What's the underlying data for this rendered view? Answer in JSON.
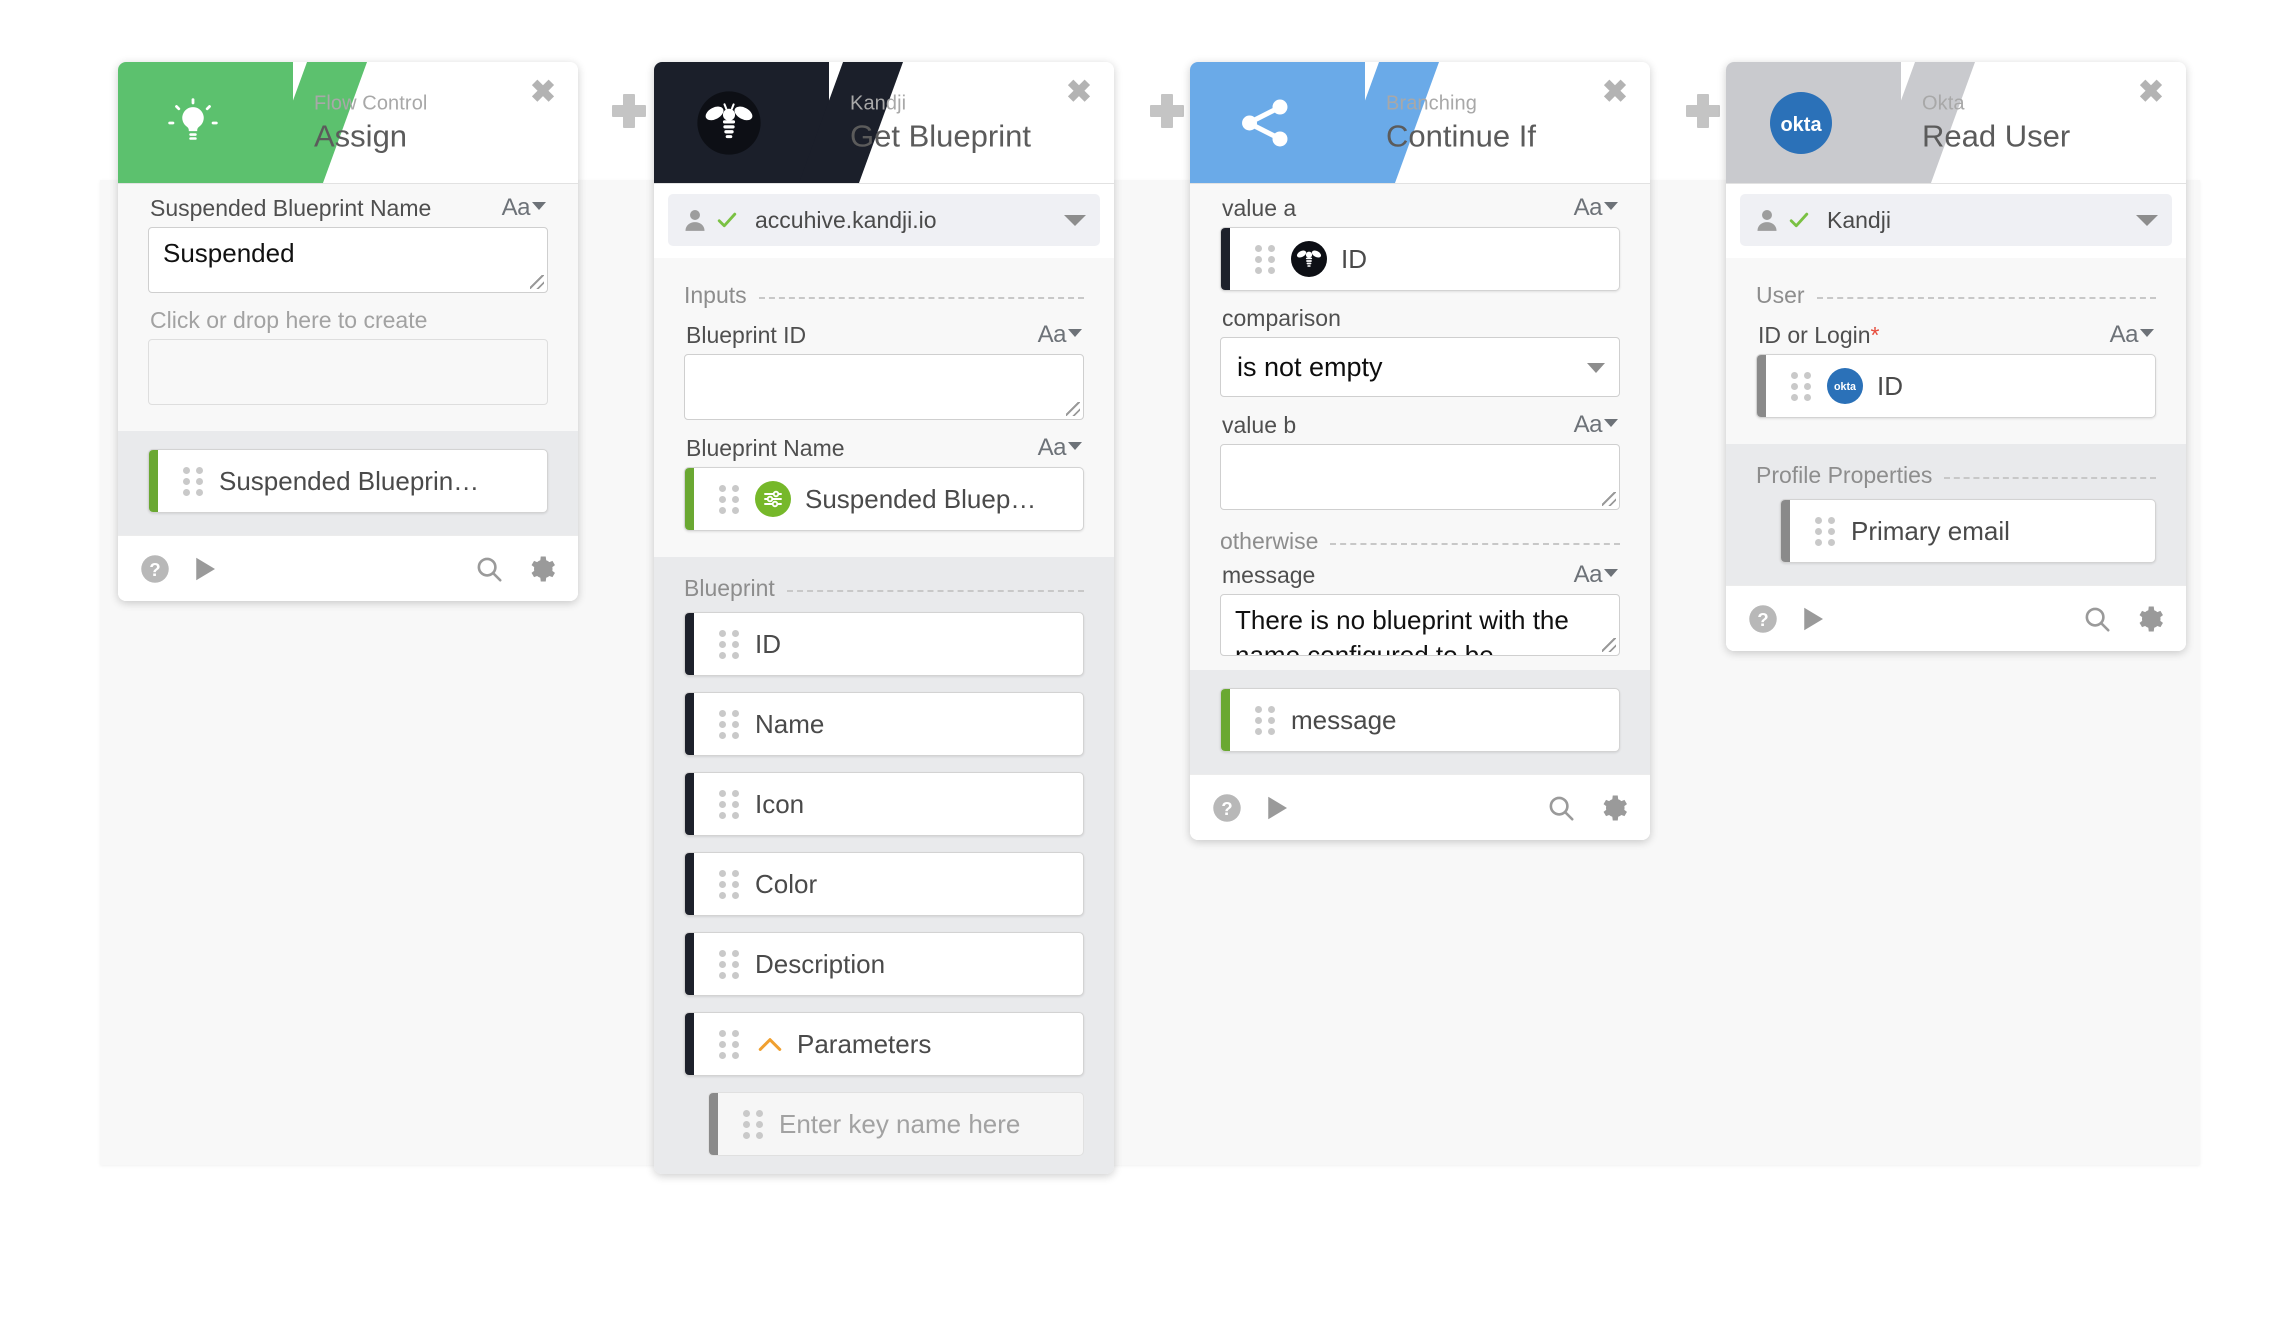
{
  "cards": [
    {
      "kicker": "Flow Control",
      "title": "Assign",
      "accent": "#5cc16e",
      "icon": "lightbulb-icon",
      "close_label": "✖",
      "fields": {
        "name_label": "Suspended Blueprint Name",
        "name_value": "Suspended",
        "aa_label": "Aa",
        "drop_label": "Click or drop here to create"
      },
      "outputs": [
        {
          "label": "Suspended Blueprin…",
          "accent": "green"
        }
      ]
    },
    {
      "kicker": "Kandji",
      "title": "Get Blueprint",
      "accent": "#1b1f2a",
      "icon": "bee-icon",
      "close_label": "✖",
      "account": {
        "name": "accuhive.kandji.io",
        "person_icon": "person-icon",
        "check_icon": "check-icon",
        "caret_icon": "chevron-down-icon"
      },
      "inputs_section": "Inputs",
      "fields": {
        "blueprint_id_label": "Blueprint ID",
        "blueprint_id_value": "",
        "blueprint_name_label": "Blueprint Name",
        "blueprint_name_token": "Suspended Bluep…",
        "aa_label": "Aa"
      },
      "outputs_section": "Blueprint",
      "outputs": [
        {
          "label": "ID",
          "accent": "dark"
        },
        {
          "label": "Name",
          "accent": "dark"
        },
        {
          "label": "Icon",
          "accent": "dark"
        },
        {
          "label": "Color",
          "accent": "dark"
        },
        {
          "label": "Description",
          "accent": "dark"
        },
        {
          "label": "Parameters",
          "accent": "dark",
          "chevron": "chevron-up-icon"
        }
      ],
      "parameters_placeholder": "Enter key name here"
    },
    {
      "kicker": "Branching",
      "title": "Continue If",
      "accent": "#6aaae8",
      "icon": "share-icon",
      "close_label": "✖",
      "fields": {
        "value_a_label": "value a",
        "value_a_token": "ID",
        "comparison_label": "comparison",
        "comparison_value": "is not empty",
        "value_b_label": "value b",
        "value_b_value": "",
        "otherwise_label": "otherwise",
        "message_label": "message",
        "message_value": "There is no blueprint with the name configured to be",
        "aa_label": "Aa"
      },
      "outputs": [
        {
          "label": "message",
          "accent": "green"
        }
      ]
    },
    {
      "kicker": "Okta",
      "title": "Read User",
      "accent": "#c9cace",
      "icon": "okta-icon",
      "close_label": "✖",
      "account": {
        "name": "Kandji",
        "person_icon": "person-icon",
        "check_icon": "check-icon",
        "caret_icon": "chevron-down-icon"
      },
      "user_section": "User",
      "fields": {
        "id_or_login_label": "ID or Login",
        "id_or_login_required": "*",
        "id_or_login_token": "ID",
        "aa_label": "Aa"
      },
      "outputs_section": "Profile Properties",
      "outputs": [
        {
          "label": "Primary email",
          "accent": "grey"
        }
      ]
    }
  ],
  "connectors": {
    "add_label": "+",
    "count": 3
  },
  "footer_icons": {
    "help": "help-icon",
    "run": "play-icon",
    "search": "search-icon",
    "settings": "gear-icon"
  }
}
